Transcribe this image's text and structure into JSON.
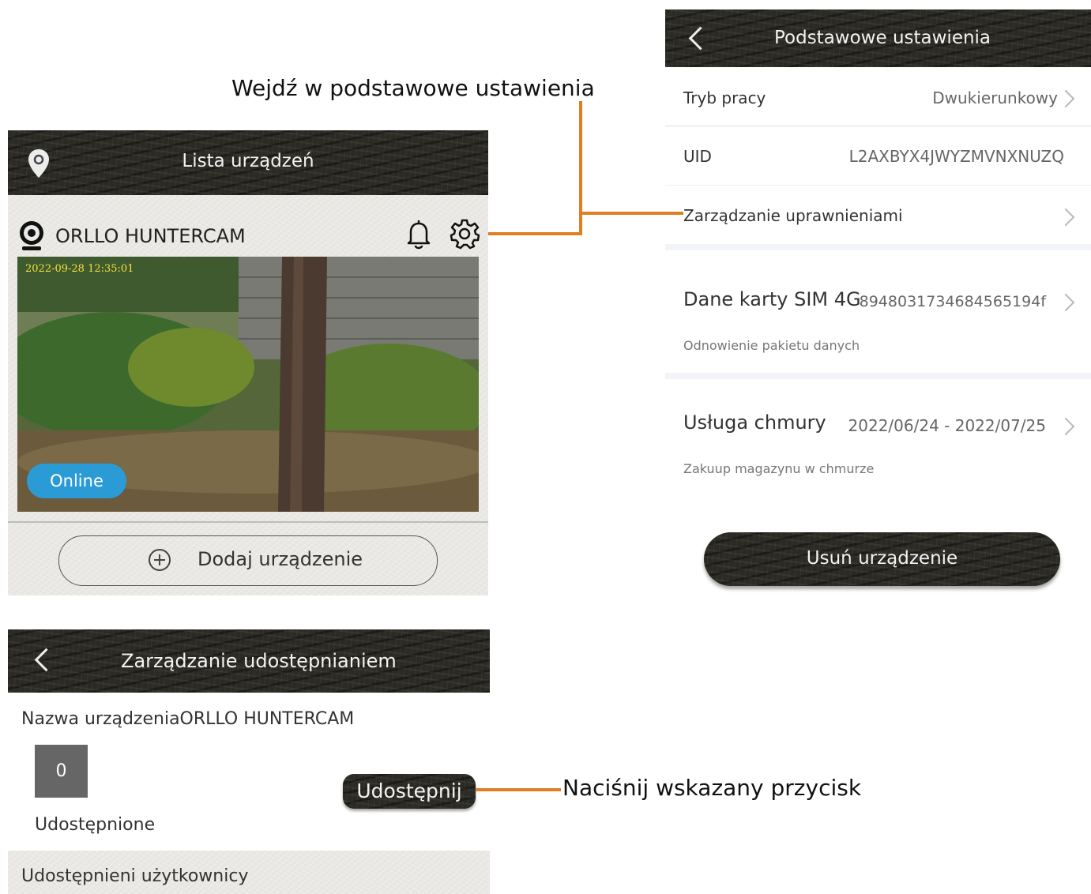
{
  "annotations": {
    "enter_settings": "Wejdź w podstawowe ustawienia",
    "press_button": "Naciśnij wskazany przycisk"
  },
  "device_list": {
    "title": "Lista urządzeń",
    "device_name": "ORLLO HUNTERCAM",
    "timestamp": "2022-09-28 12:35:01",
    "status": "Online",
    "add_device_label": "Dodaj urządzenie"
  },
  "basic_settings": {
    "title": "Podstawowe ustawienia",
    "rows": [
      {
        "label": "Tryb pracy",
        "value": "Dwukierunkowy"
      },
      {
        "label": "UID",
        "value": "L2AXBYX4JWYZMVNXNUZQ"
      },
      {
        "label": "Zarządzanie uprawnieniami",
        "value": ""
      }
    ],
    "sim": {
      "label": "Dane karty SIM 4G",
      "value": "8948031734684565194f",
      "sub": "Odnowienie pakietu danych"
    },
    "cloud": {
      "label": "Usługa chmury",
      "value": "2022/06/24 - 2022/07/25",
      "sub": "Zakuup magazynu w chmurze"
    },
    "delete_label": "Usuń urządzenie"
  },
  "share_management": {
    "title": "Zarządzanie udostępnianiem",
    "device_name_line": "Nazwa urządzeniaORLLO HUNTERCAM",
    "count": "0",
    "shared_label": "Udostępnione",
    "share_button": "Udostępnij",
    "shared_users_label": "Udostępnieni użytkownicy"
  },
  "colors": {
    "accent_orange": "#e07f22",
    "online_blue": "#2b9bd6"
  }
}
